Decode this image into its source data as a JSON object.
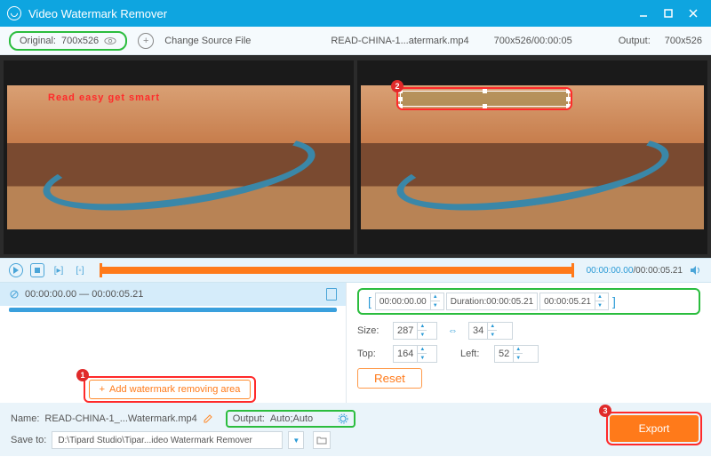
{
  "app": {
    "title": "Video Watermark Remover"
  },
  "toolbar": {
    "original_label": "Original:",
    "original_dim": "700x526",
    "change_source": "Change Source File",
    "filename": "READ-CHINA-1...atermark.mp4",
    "file_info": "700x526/00:00:05",
    "output_label": "Output:",
    "output_dim": "700x526"
  },
  "preview": {
    "watermark_text": "Read easy get smart"
  },
  "callouts": {
    "n1": "1",
    "n2": "2",
    "n3": "3"
  },
  "timeline": {
    "current": "00:00:00.00",
    "total": "/00:00:05.21"
  },
  "segment": {
    "range": "00:00:00.00 — 00:00:05.21"
  },
  "add_area": {
    "label": "Add watermark removing area"
  },
  "range": {
    "start": "00:00:00.00",
    "duration_label": "Duration:",
    "duration": "00:00:05.21",
    "end": "00:00:05.21"
  },
  "size": {
    "label": "Size:",
    "w": "287",
    "h": "34",
    "top_label": "Top:",
    "top": "164",
    "left_label": "Left:",
    "left": "52"
  },
  "reset": {
    "label": "Reset"
  },
  "footer": {
    "name_label": "Name:",
    "name_value": "READ-CHINA-1_...Watermark.mp4",
    "output_label": "Output:",
    "output_value": "Auto;Auto",
    "save_label": "Save to:",
    "save_path": "D:\\Tipard Studio\\Tipar...ideo Watermark Remover",
    "export": "Export"
  }
}
